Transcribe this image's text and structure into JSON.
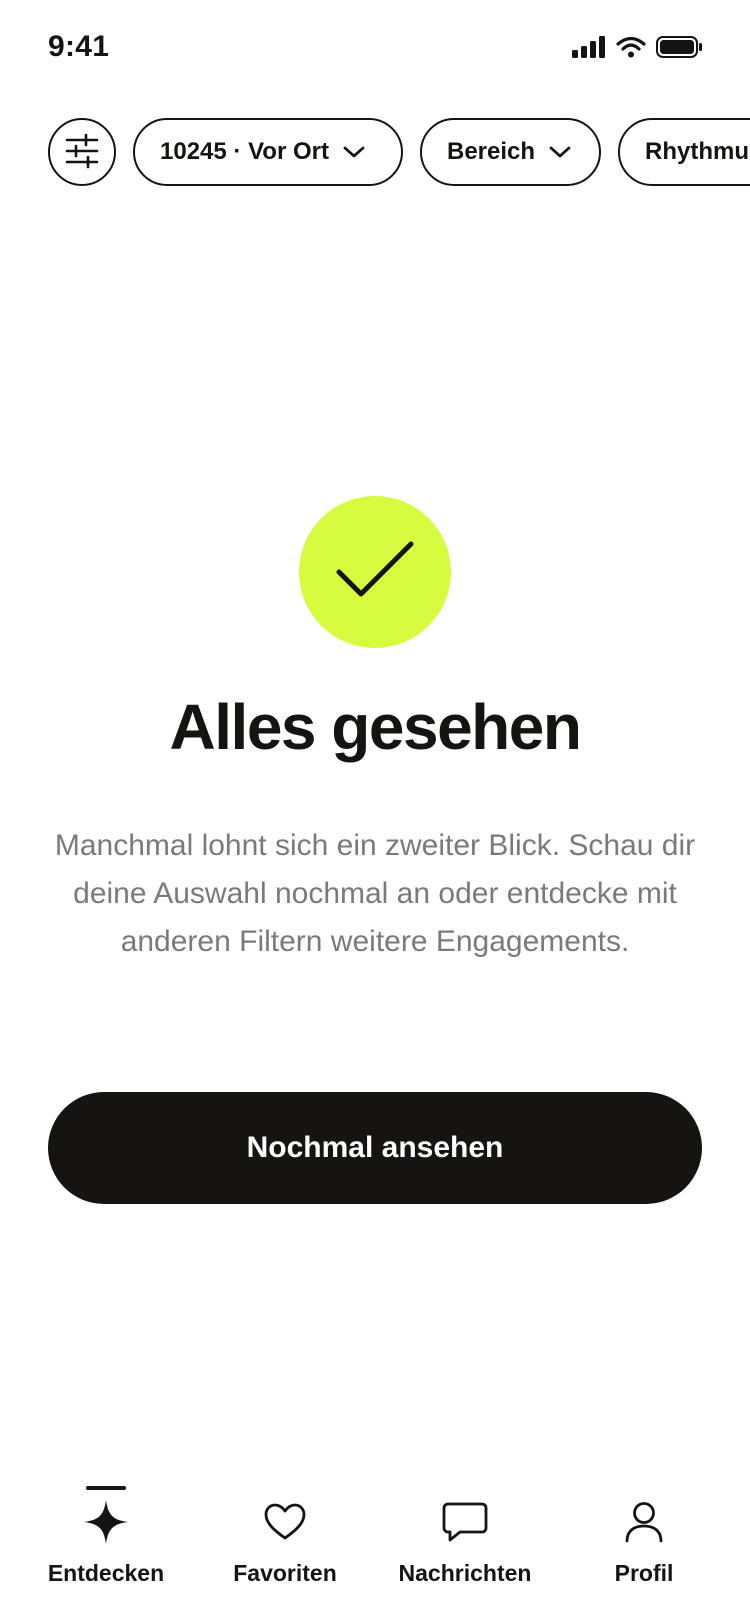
{
  "status_bar": {
    "time": "9:41"
  },
  "filters": {
    "location_chip": "10245 · Vor Ort",
    "area_chip": "Bereich",
    "rhythm_chip": "Rhythmus"
  },
  "empty_state": {
    "title": "Alles gesehen",
    "body": "Manchmal lohnt sich ein zweiter Blick. Schau dir deine Auswahl nochmal an oder entdecke mit anderen Filtern weitere Engagements.",
    "cta_label": "Nochmal ansehen"
  },
  "bottom_nav": {
    "items": [
      {
        "label": "Entdecken",
        "icon": "sparkle-icon",
        "active": true
      },
      {
        "label": "Favoriten",
        "icon": "heart-icon",
        "active": false
      },
      {
        "label": "Nachrichten",
        "icon": "chat-bubble-icon",
        "active": false
      },
      {
        "label": "Profil",
        "icon": "person-icon",
        "active": false
      }
    ]
  },
  "colors": {
    "accent": "#d6fb3f",
    "ink": "#151412",
    "muted_text": "#7a7a7a",
    "background": "#ffffff"
  }
}
